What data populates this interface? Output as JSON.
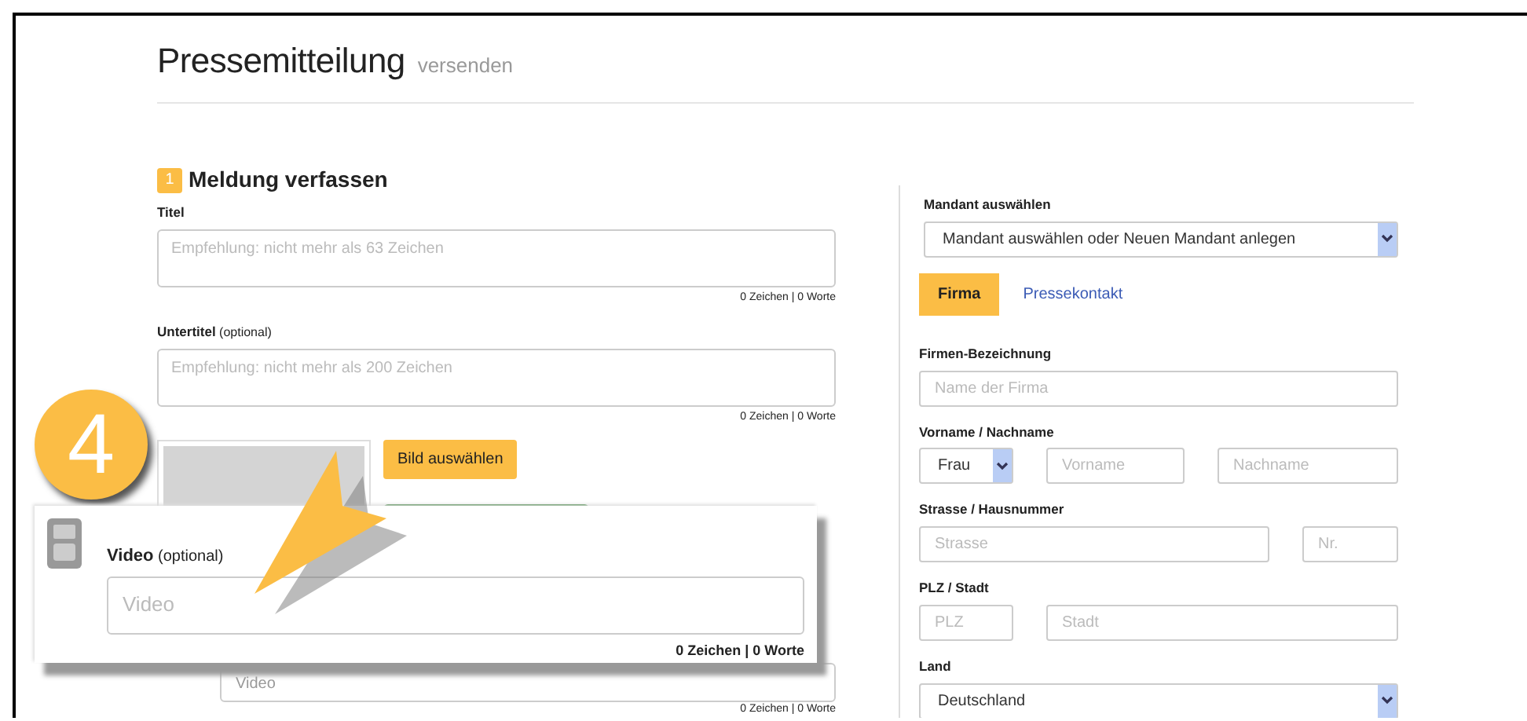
{
  "header": {
    "title": "Pressemitteilung",
    "subtitle": "versenden"
  },
  "step": {
    "number": "1",
    "title": "Meldung verfassen"
  },
  "fields": [
    {
      "label": "Titel",
      "placeholder": "Empfehlung: nicht mehr als 63 Zeichen",
      "counter": "0 Zeichen | 0 Worte"
    },
    {
      "label": "Untertitel",
      "note": "(optional)",
      "placeholder": "Empfehlung: nicht mehr als 200 Zeichen",
      "counter": "0 Zeichen | 0 Worte"
    }
  ],
  "image": {
    "button": "Bild auswählen"
  },
  "video_field": {
    "placeholder": "Video",
    "counter": "0 Zeichen | 0 Worte"
  },
  "callout": {
    "badge": "4",
    "label": "Video",
    "note": "(optional)",
    "placeholder": "Video",
    "counter": "0 Zeichen | 0 Worte"
  },
  "client": {
    "label": "Mandant auswählen",
    "value": "Mandant auswählen oder Neuen Mandant anlegen"
  },
  "tabs": [
    {
      "label": "Firma",
      "selected": true
    },
    {
      "label": "Pressekontakt",
      "selected": false
    }
  ],
  "form": [
    {
      "label": "Firmen-Bezeichnung",
      "controls": [
        {
          "kind": "input",
          "placeholder": "Name der Firma"
        }
      ]
    },
    {
      "label": "Vorname / Nachname",
      "controls": [
        {
          "kind": "select",
          "value": "Frau"
        },
        {
          "kind": "input",
          "placeholder": "Vorname"
        },
        {
          "kind": "input",
          "placeholder": "Nachname"
        }
      ]
    },
    {
      "label": "Strasse / Hausnummer",
      "controls": [
        {
          "kind": "input",
          "placeholder": "Strasse"
        },
        {
          "kind": "input",
          "placeholder": "Nr."
        }
      ]
    },
    {
      "label": "PLZ / Stadt",
      "controls": [
        {
          "kind": "input",
          "placeholder": "PLZ"
        },
        {
          "kind": "input",
          "placeholder": "Stadt"
        }
      ]
    },
    {
      "label": "Land",
      "controls": [
        {
          "kind": "select",
          "value": "Deutschland"
        }
      ]
    }
  ]
}
